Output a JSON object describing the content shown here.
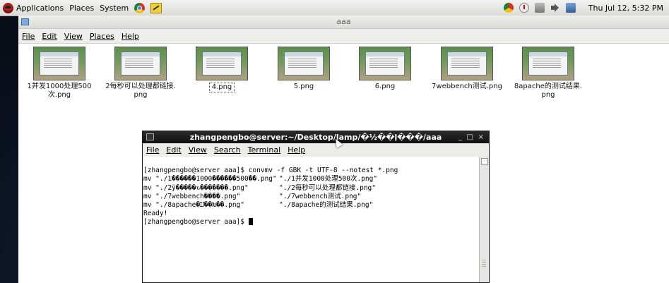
{
  "top_panel": {
    "menus": [
      "Applications",
      "Places",
      "System"
    ],
    "clock": "Thu Jul 12,  5:32 PM",
    "launchers": [
      "chrome-icon",
      "edit-icon"
    ],
    "tray_icons": [
      "chrome-icon",
      "update-icon",
      "network-icon",
      "volume-icon",
      "users-icon"
    ]
  },
  "file_manager": {
    "title": "aaa",
    "menu": [
      "File",
      "Edit",
      "View",
      "Places",
      "Help"
    ],
    "files": [
      {
        "name": "1并发1000处理500次.png"
      },
      {
        "name": "2每秒可以处理都链接.png"
      },
      {
        "name": "4.png",
        "selected": true
      },
      {
        "name": "5.png"
      },
      {
        "name": "6.png"
      },
      {
        "name": "7webbench测试.png"
      },
      {
        "name": "8apache的测试结果.png"
      }
    ]
  },
  "terminal": {
    "title": "zhangpengbo@server:~/Desktop/lamp/�½��ļ���/aaa",
    "controls": [
      "_",
      "□",
      "×"
    ],
    "menu": [
      "File",
      "Edit",
      "View",
      "Search",
      "Terminal",
      "Help"
    ],
    "lines": [
      {
        "a": "[zhangpengbo@server aaa]$ convmv -f GBK -t UTF-8 --notest *.png",
        "b": ""
      },
      {
        "a": "mv \"./1������1000������500��.png\"",
        "b": "\"./1并发1000处理500次.png\""
      },
      {
        "a": "mv \"./2ÿ�����ԏ�������.png\"",
        "b": "\"./2每秒可以处理都链接.png\""
      },
      {
        "a": "mv \"./7webbench����.png\"",
        "b": "\"./7webbench测试.png\""
      },
      {
        "a": "mv \"./8apache�Ĳ��Խ��.png\"",
        "b": "\"./8apache的测试结果.png\""
      },
      {
        "a": "Ready!",
        "b": ""
      }
    ],
    "prompt": "[zhangpengbo@server aaa]$ "
  },
  "colors": {
    "panel_bg": "#e8e8e4",
    "terminal_titlebar": "#1a1a1a",
    "desktop_bg": "#0b1220"
  }
}
